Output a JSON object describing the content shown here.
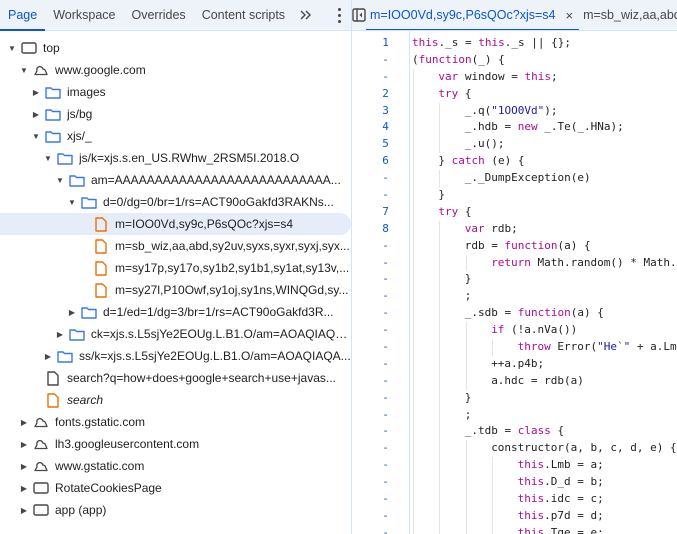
{
  "left_panel": {
    "tabs": [
      {
        "label": "Page",
        "active": true
      },
      {
        "label": "Workspace",
        "active": false
      },
      {
        "label": "Overrides",
        "active": false
      },
      {
        "label": "Content scripts",
        "active": false
      }
    ],
    "more_tabs_label": "»",
    "tree": [
      {
        "label": "top",
        "icon": "frame-icon",
        "depth": 0,
        "expanded": true
      },
      {
        "label": "www.google.com",
        "icon": "cloud-icon",
        "depth": 1,
        "expanded": true
      },
      {
        "label": "images",
        "icon": "folder-icon",
        "depth": 2,
        "expanded": false
      },
      {
        "label": "js/bg",
        "icon": "folder-icon",
        "depth": 2,
        "expanded": false
      },
      {
        "label": "xjs/_",
        "icon": "folder-icon",
        "depth": 2,
        "expanded": true
      },
      {
        "label": "js/k=xjs.s.en_US.RWhw_2RSM5I.2018.O",
        "icon": "folder-icon",
        "depth": 3,
        "expanded": true
      },
      {
        "label": "am=AAAAAAAAAAAAAAAAAAAAAAAAAAA...",
        "icon": "folder-icon",
        "depth": 4,
        "expanded": true
      },
      {
        "label": "d=0/dg=0/br=1/rs=ACT90oGakfd3RAKNs...",
        "icon": "folder-icon",
        "depth": 5,
        "expanded": true
      },
      {
        "label": "m=IOO0Vd,sy9c,P6sQOc?xjs=s4",
        "icon": "script-file-icon",
        "depth": 6,
        "selected": true
      },
      {
        "label": "m=sb_wiz,aa,abd,sy2uv,syxs,syxr,syxj,syx...",
        "icon": "script-file-icon",
        "depth": 6
      },
      {
        "label": "m=sy17p,sy17o,sy1b2,sy1b1,sy1at,sy13v,...",
        "icon": "script-file-icon",
        "depth": 6
      },
      {
        "label": "m=sy27l,P10Owf,sy1oj,sy1ns,WINQGd,sy...",
        "icon": "script-file-icon",
        "depth": 6
      },
      {
        "label": "d=1/ed=1/dg=3/br=1/rs=ACT90oGakfd3R...",
        "icon": "folder-icon",
        "depth": 5,
        "expanded": false
      },
      {
        "label": "ck=xjs.s.L5sjYe2EOUg.L.B1.O/am=AOAQIAQA...",
        "icon": "folder-icon",
        "depth": 4,
        "expanded": false
      },
      {
        "label": "ss/k=xjs.s.L5sjYe2EOUg.L.B1.O/am=AOAQIAQA...",
        "icon": "folder-icon",
        "depth": 3,
        "expanded": false
      },
      {
        "label": "search?q=how+does+google+search+use+javas...",
        "icon": "document-file-icon",
        "depth": 2
      },
      {
        "label": "search",
        "icon": "script-file-icon",
        "depth": 2,
        "italic": true
      },
      {
        "label": "fonts.gstatic.com",
        "icon": "cloud-icon",
        "depth": 1,
        "expanded": false
      },
      {
        "label": "lh3.googleusercontent.com",
        "icon": "cloud-icon",
        "depth": 1,
        "expanded": false
      },
      {
        "label": "www.gstatic.com",
        "icon": "cloud-icon",
        "depth": 1,
        "expanded": false
      },
      {
        "label": "RotateCookiesPage",
        "icon": "frame-icon",
        "depth": 1,
        "expanded": false
      },
      {
        "label": "app (app)",
        "icon": "frame-icon",
        "depth": 1,
        "expanded": false
      }
    ]
  },
  "editor": {
    "tabs": [
      {
        "label": "m=IOO0Vd,sy9c,P6sQOc?xjs=s4",
        "active": true,
        "closable": true
      },
      {
        "label": "m=sb_wiz,aa,abd",
        "active": false
      }
    ],
    "close_label": "×",
    "lines": [
      {
        "num": "1",
        "indent": 0,
        "code": [
          [
            "kw",
            "this"
          ],
          [
            "",
            "._s = "
          ],
          [
            "kw",
            "this"
          ],
          [
            "",
            "._s || {};"
          ]
        ]
      },
      {
        "num": "-",
        "indent": 0,
        "code": [
          [
            "",
            "("
          ],
          [
            "kw",
            "function"
          ],
          [
            "",
            "(_) {"
          ]
        ]
      },
      {
        "num": "-",
        "indent": 1,
        "code": [
          [
            "kw",
            "var"
          ],
          [
            "",
            " window = "
          ],
          [
            "kw",
            "this"
          ],
          [
            "",
            ";"
          ]
        ]
      },
      {
        "num": "2",
        "indent": 1,
        "code": [
          [
            "kw",
            "try"
          ],
          [
            "",
            " {"
          ]
        ]
      },
      {
        "num": "3",
        "indent": 2,
        "code": [
          [
            "",
            "_.q("
          ],
          [
            "str",
            "\"1OO0Vd\""
          ],
          [
            "",
            ");"
          ]
        ]
      },
      {
        "num": "4",
        "indent": 2,
        "code": [
          [
            "",
            "_.hdb = "
          ],
          [
            "kw",
            "new"
          ],
          [
            "",
            " _.Te(_.HNa);"
          ]
        ]
      },
      {
        "num": "5",
        "indent": 2,
        "code": [
          [
            "",
            "_.u();"
          ]
        ]
      },
      {
        "num": "6",
        "indent": 1,
        "code": [
          [
            "",
            "} "
          ],
          [
            "kw",
            "catch"
          ],
          [
            "",
            " (e) {"
          ]
        ]
      },
      {
        "num": "-",
        "indent": 2,
        "code": [
          [
            "",
            "_._DumpException(e)"
          ]
        ]
      },
      {
        "num": "-",
        "indent": 1,
        "code": [
          [
            "",
            "}"
          ]
        ]
      },
      {
        "num": "7",
        "indent": 1,
        "code": [
          [
            "kw",
            "try"
          ],
          [
            "",
            " {"
          ]
        ]
      },
      {
        "num": "8",
        "indent": 2,
        "code": [
          [
            "kw",
            "var"
          ],
          [
            "",
            " rdb;"
          ]
        ]
      },
      {
        "num": "-",
        "indent": 2,
        "code": [
          [
            "",
            "rdb = "
          ],
          [
            "kw",
            "function"
          ],
          [
            "",
            "(a) {"
          ]
        ]
      },
      {
        "num": "-",
        "indent": 3,
        "code": [
          [
            "kw",
            "return"
          ],
          [
            "",
            " Math.random() * Math."
          ]
        ]
      },
      {
        "num": "-",
        "indent": 2,
        "code": [
          [
            "",
            "}"
          ]
        ]
      },
      {
        "num": "-",
        "indent": 2,
        "code": [
          [
            "",
            ";"
          ]
        ]
      },
      {
        "num": "-",
        "indent": 2,
        "code": [
          [
            "",
            "_.sdb = "
          ],
          [
            "kw",
            "function"
          ],
          [
            "",
            "(a) {"
          ]
        ]
      },
      {
        "num": "-",
        "indent": 3,
        "code": [
          [
            "kw",
            "if"
          ],
          [
            "",
            " (!a.nVa())"
          ]
        ]
      },
      {
        "num": "-",
        "indent": 4,
        "code": [
          [
            "kw",
            "throw"
          ],
          [
            "",
            " Error("
          ],
          [
            "str",
            "\"He`\""
          ],
          [
            "",
            " + a.Lm"
          ]
        ]
      },
      {
        "num": "-",
        "indent": 3,
        "code": [
          [
            "",
            "++a.p4b;"
          ]
        ]
      },
      {
        "num": "-",
        "indent": 3,
        "code": [
          [
            "",
            "a.hdc = rdb(a)"
          ]
        ]
      },
      {
        "num": "-",
        "indent": 2,
        "code": [
          [
            "",
            "}"
          ]
        ]
      },
      {
        "num": "-",
        "indent": 2,
        "code": [
          [
            "",
            ";"
          ]
        ]
      },
      {
        "num": "-",
        "indent": 2,
        "code": [
          [
            "",
            "_.tdb = "
          ],
          [
            "kw",
            "class"
          ],
          [
            "",
            " {"
          ]
        ]
      },
      {
        "num": "-",
        "indent": 3,
        "code": [
          [
            "",
            "constructor(a, b, c, d, e) {"
          ]
        ]
      },
      {
        "num": "-",
        "indent": 4,
        "code": [
          [
            "kw",
            "this"
          ],
          [
            "",
            ".Lmb = a;"
          ]
        ]
      },
      {
        "num": "-",
        "indent": 4,
        "code": [
          [
            "kw",
            "this"
          ],
          [
            "",
            ".D_d = b;"
          ]
        ]
      },
      {
        "num": "-",
        "indent": 4,
        "code": [
          [
            "kw",
            "this"
          ],
          [
            "",
            ".idc = c;"
          ]
        ]
      },
      {
        "num": "-",
        "indent": 4,
        "code": [
          [
            "kw",
            "this"
          ],
          [
            "",
            ".p7d = d;"
          ]
        ]
      },
      {
        "num": "-",
        "indent": 4,
        "code": [
          [
            "kw",
            "this"
          ],
          [
            "",
            ".Tge = e;"
          ]
        ]
      }
    ]
  },
  "colors": {
    "accent": "#0b57d0",
    "keyword": "#aa0d91",
    "string": "#1a1aa6",
    "folder": "#3b78e7",
    "script_file": "#e8710a",
    "selected_row": "#e6edf8"
  }
}
